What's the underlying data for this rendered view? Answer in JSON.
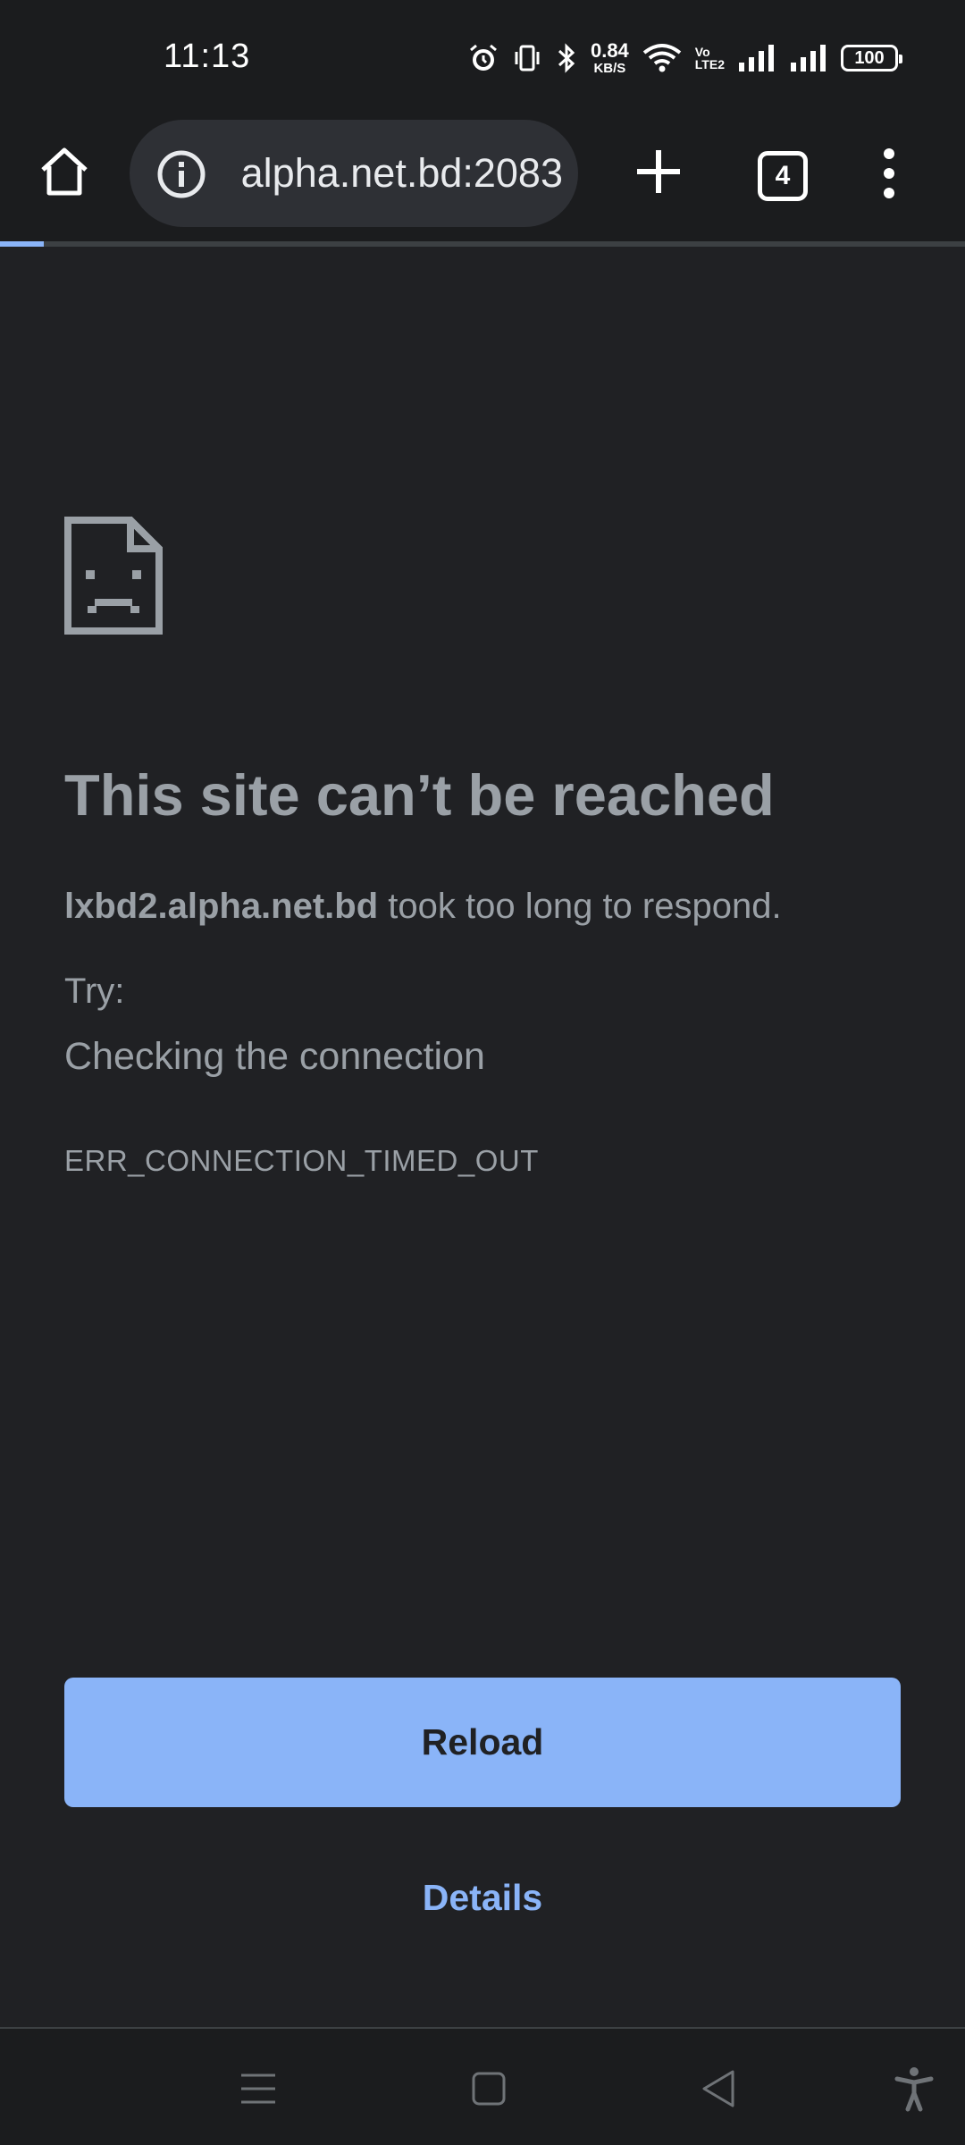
{
  "status_bar": {
    "time": "11:13",
    "net_speed_value": "0.84",
    "net_speed_unit": "KB/S",
    "volte_top": "Vo",
    "volte_bottom": "LTE2",
    "battery": "100",
    "icons": [
      "alarm-icon",
      "vibrate-icon",
      "bluetooth-icon",
      "wifi-icon",
      "signal-1-icon",
      "signal-2-icon",
      "battery-icon"
    ]
  },
  "toolbar": {
    "url": "alpha.net.bd:2083",
    "tab_count": "4",
    "icons": [
      "home-icon",
      "info-icon",
      "new-tab-icon",
      "tab-switcher-icon",
      "menu-icon"
    ]
  },
  "progress": {
    "fraction": 0.045
  },
  "error": {
    "title": "This site can’t be reached",
    "host": "lxbd2.alpha.net.bd",
    "message": " took too long to respond.",
    "try_label": "Try:",
    "suggestion": "Checking the connection",
    "code": "ERR_CONNECTION_TIMED_OUT"
  },
  "actions": {
    "reload_label": "Reload",
    "details_label": "Details"
  },
  "nav_bar": {
    "icons": [
      "recents-icon",
      "home-nav-icon",
      "back-icon",
      "accessibility-icon"
    ]
  },
  "colors": {
    "background": "#202124",
    "accent": "#8ab4f8",
    "text": "#9aa0a6"
  }
}
